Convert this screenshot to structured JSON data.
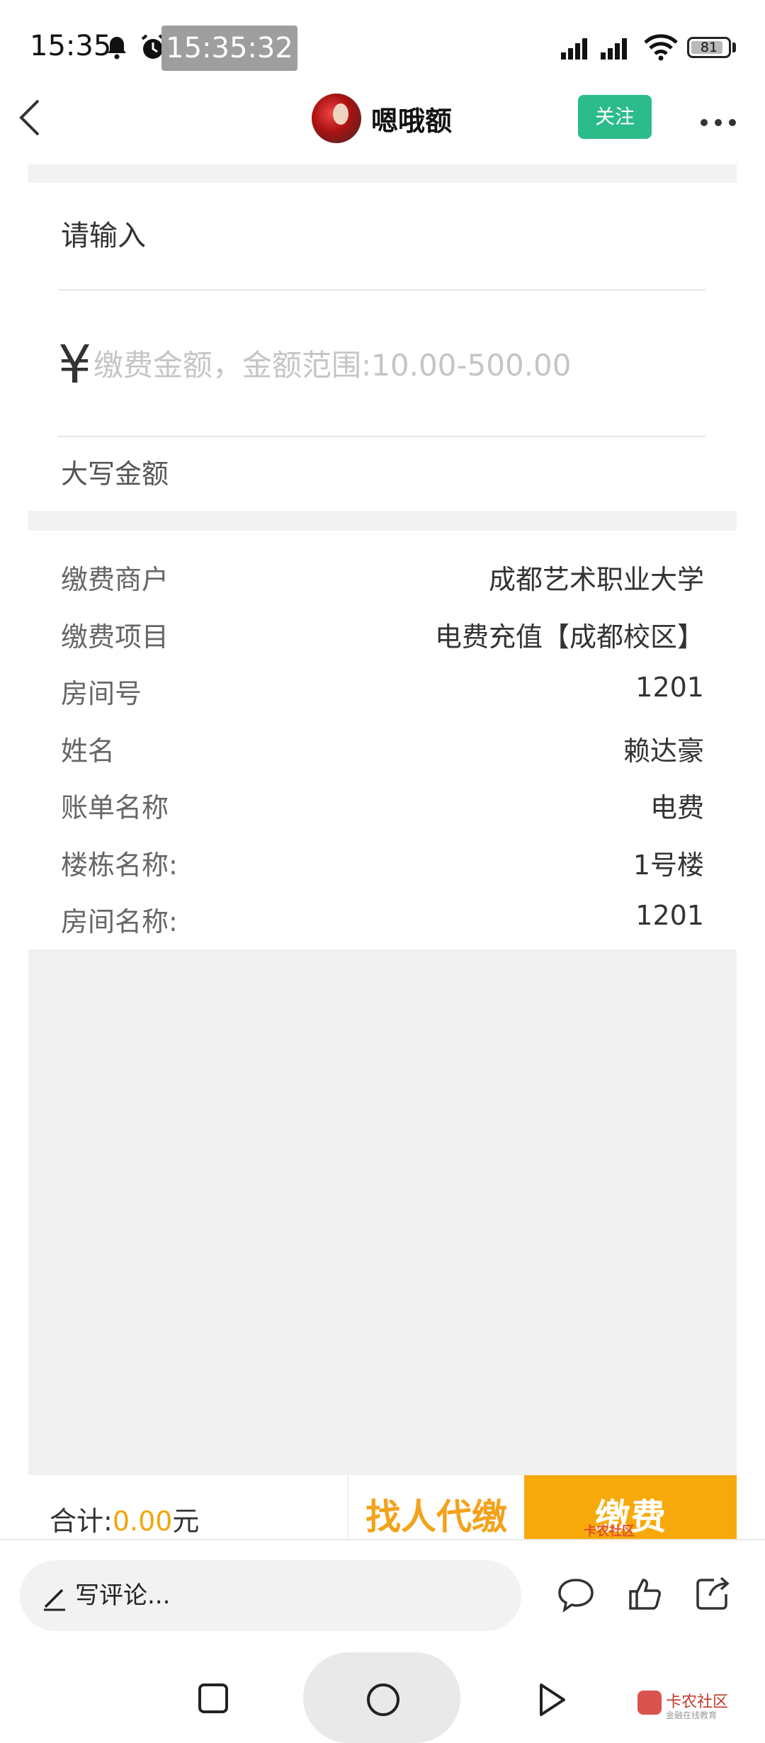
{
  "status_bar": {
    "time": "15:35",
    "clock_pill": "15:35:32",
    "battery": "81"
  },
  "header": {
    "author_name": "嗯哦额",
    "follow_label": "关注"
  },
  "form": {
    "title": "请输入",
    "currency_symbol": "¥",
    "amount_placeholder": "缴费金额，金额范围:10.00-500.00",
    "uppercase_label": "大写金额"
  },
  "info": [
    {
      "label": "缴费商户",
      "value": "成都艺术职业大学"
    },
    {
      "label": "缴费项目",
      "value": "电费充值【成都校区】"
    },
    {
      "label": "房间号",
      "value": "1201"
    },
    {
      "label": "姓名",
      "value": "赖达豪"
    },
    {
      "label": "账单名称",
      "value": "电费"
    },
    {
      "label": "楼栋名称:",
      "value": "1号楼"
    },
    {
      "label": "房间名称:",
      "value": "1201"
    }
  ],
  "footer": {
    "total_label": "合计:",
    "total_value": "0.00",
    "total_unit": "元",
    "proxy_pay_label": "找人代缴",
    "pay_label": "缴费",
    "pay_watermark": "卡农社区"
  },
  "comment_bar": {
    "placeholder": "写评论..."
  },
  "watermark": {
    "title": "卡农社区",
    "subtitle": "金融在线教育"
  },
  "colors": {
    "accent_green": "#2bbc8a",
    "accent_orange": "#f7a90b"
  }
}
